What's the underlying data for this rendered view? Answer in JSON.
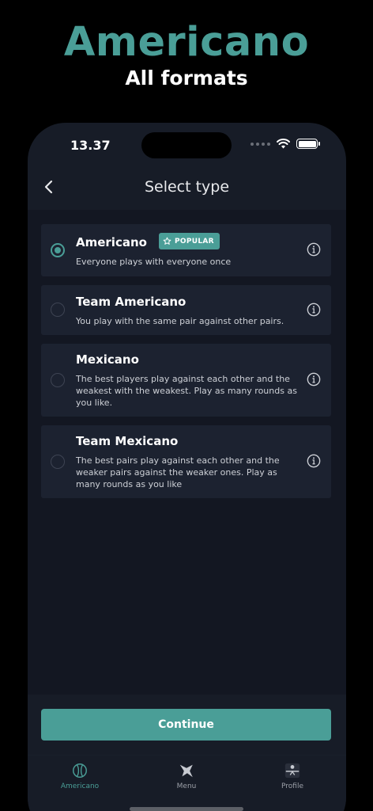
{
  "promo": {
    "title": "Americano",
    "subtitle": "All formats"
  },
  "status_bar": {
    "time": "13.37"
  },
  "header": {
    "title": "Select type"
  },
  "options": [
    {
      "title": "Americano",
      "badge": "POPULAR",
      "description": "Everyone plays with everyone once",
      "selected": true
    },
    {
      "title": "Team Americano",
      "description": "You play with the same pair against other pairs.",
      "selected": false
    },
    {
      "title": "Mexicano",
      "description": "The best players play against each other and the weakest with the weakest. Play as many rounds as you like.",
      "selected": false
    },
    {
      "title": "Team Mexicano",
      "description": "The best pairs play against each other and the weaker pairs against the weaker ones. Play as many rounds as you like",
      "selected": false
    }
  ],
  "continue_label": "Continue",
  "tabs": [
    {
      "label": "Americano",
      "icon": "ball-icon",
      "active": true
    },
    {
      "label": "Menu",
      "icon": "star-icon",
      "active": false
    },
    {
      "label": "Profile",
      "icon": "avatar",
      "active": false
    }
  ],
  "colors": {
    "accent": "#4a9e97",
    "background": "#000000",
    "card": "#1c2230"
  }
}
